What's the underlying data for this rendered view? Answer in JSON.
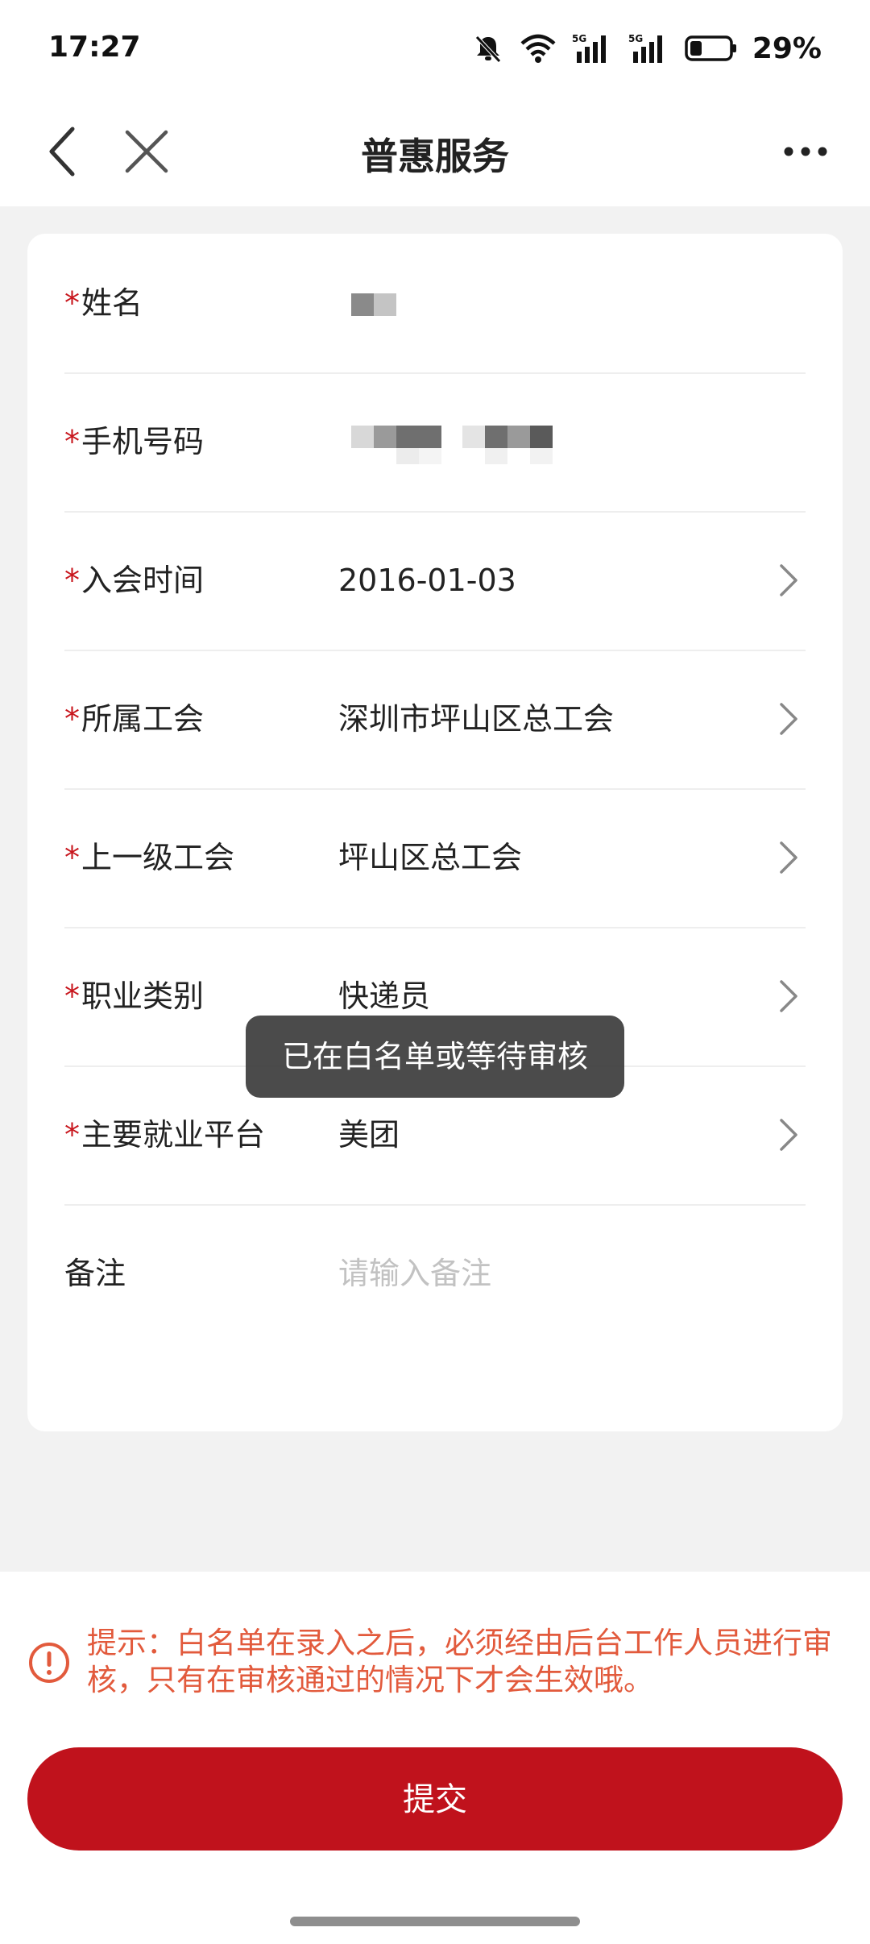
{
  "status_bar": {
    "time": "17:27",
    "battery": "29%",
    "icons": [
      "bell-muted-icon",
      "wifi-icon",
      "signal-5g-icon",
      "signal-5g-icon",
      "battery-icon"
    ]
  },
  "nav": {
    "title": "普惠服务",
    "back_icon": "chevron-left-icon",
    "close_icon": "close-icon",
    "more_icon": "more-dots-icon"
  },
  "form": {
    "rows": [
      {
        "label": "姓名",
        "required": true,
        "value": "",
        "masked": true
      },
      {
        "label": "手机号码",
        "required": true,
        "value": "",
        "masked": true
      },
      {
        "label": "入会时间",
        "required": true,
        "value": "2016-01-03"
      },
      {
        "label": "所属工会",
        "required": true,
        "value": "深圳市坪山区总工会"
      },
      {
        "label": "上一级工会",
        "required": true,
        "value": "坪山区总工会"
      },
      {
        "label": "职业类别",
        "required": true,
        "value": "快递员"
      },
      {
        "label": "主要就业平台",
        "required": true,
        "value": "美团"
      },
      {
        "label": "备注",
        "required": false,
        "placeholder": "请输入备注"
      }
    ],
    "required_mark": "*"
  },
  "toast": {
    "text": "已在白名单或等待审核"
  },
  "hint": {
    "text": "提示：白名单在录入之后，必须经由后台工作人员进行审核，只有在审核通过的情况下才会生效哦。",
    "icon": "alert-circle-icon"
  },
  "submit": {
    "label": "提交"
  },
  "colors": {
    "brand_red": "#c0121c",
    "hint_orange": "#e25a3c",
    "required_red": "#c8161d"
  }
}
